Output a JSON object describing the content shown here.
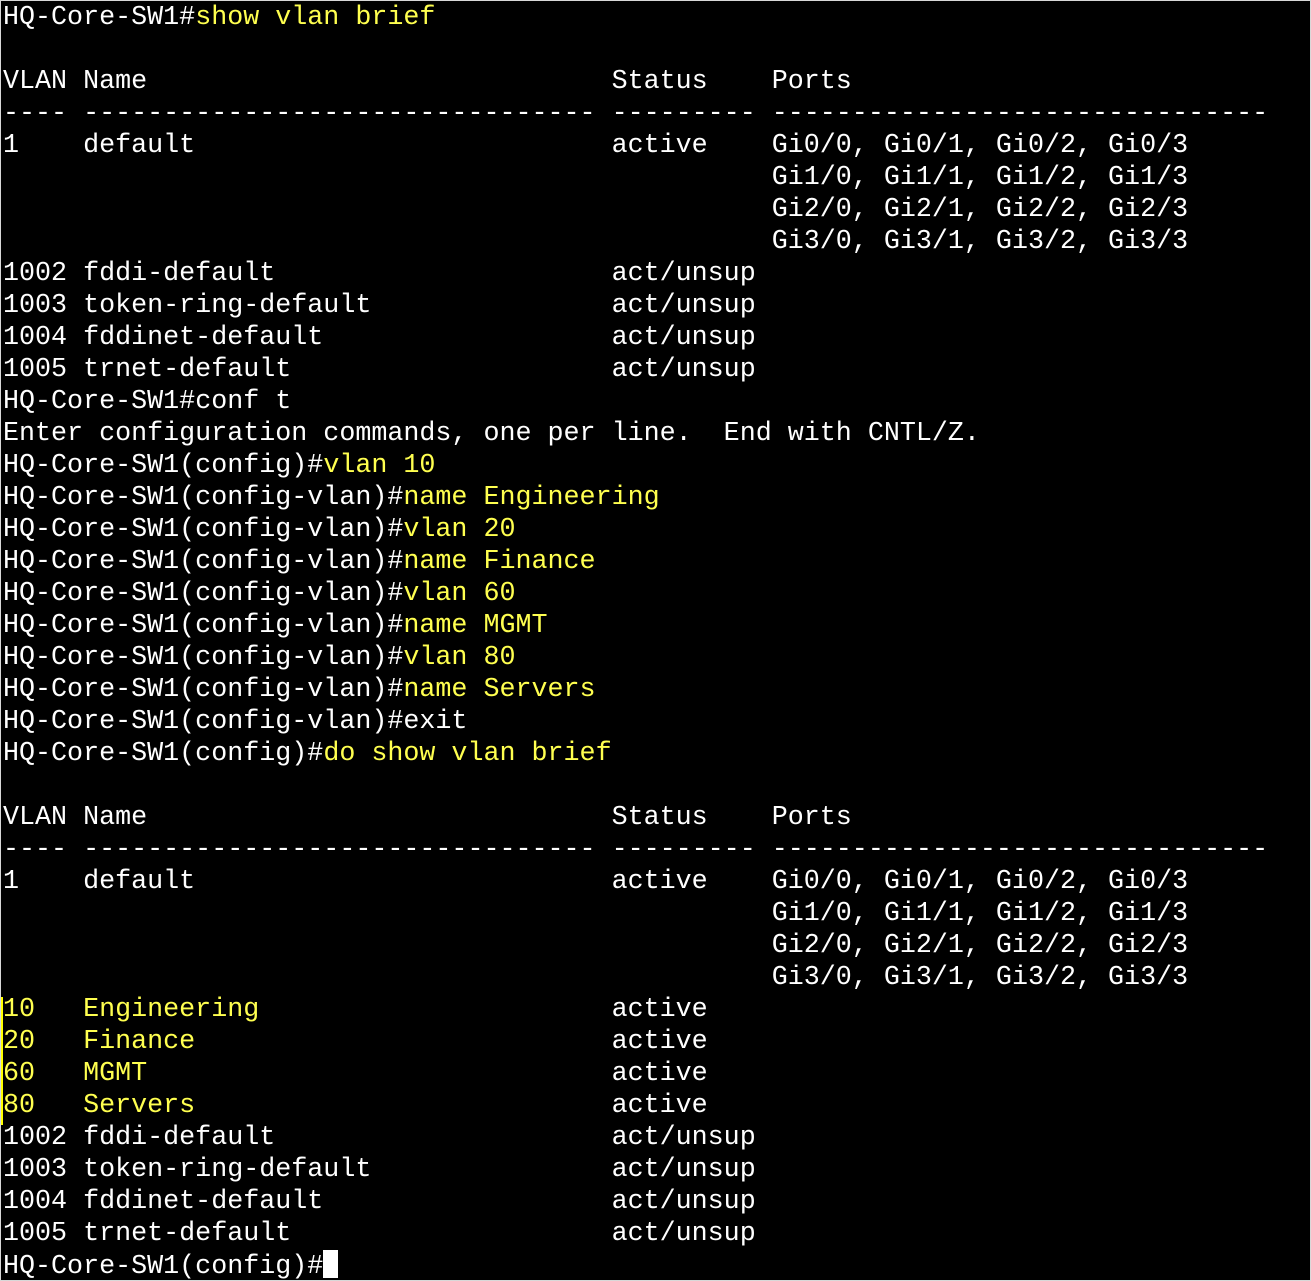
{
  "terminal": {
    "colors": {
      "background": "#000000",
      "output": "#ffffff",
      "command": "#ffff4f"
    },
    "lines": [
      [
        {
          "t": "HQ-Core-SW1#",
          "c": "w"
        },
        {
          "t": "show vlan brief",
          "c": "y"
        }
      ],
      [],
      [
        {
          "t": "VLAN Name                             Status    Ports",
          "c": "w"
        }
      ],
      [
        {
          "t": "---- -------------------------------- --------- -------------------------------",
          "c": "w"
        }
      ],
      [
        {
          "t": "1    default                          active    Gi0/0, Gi0/1, Gi0/2, Gi0/3",
          "c": "w"
        }
      ],
      [
        {
          "t": "                                                Gi1/0, Gi1/1, Gi1/2, Gi1/3",
          "c": "w"
        }
      ],
      [
        {
          "t": "                                                Gi2/0, Gi2/1, Gi2/2, Gi2/3",
          "c": "w"
        }
      ],
      [
        {
          "t": "                                                Gi3/0, Gi3/1, Gi3/2, Gi3/3",
          "c": "w"
        }
      ],
      [
        {
          "t": "1002 fddi-default                     act/unsup",
          "c": "w"
        }
      ],
      [
        {
          "t": "1003 token-ring-default               act/unsup",
          "c": "w"
        }
      ],
      [
        {
          "t": "1004 fddinet-default                  act/unsup",
          "c": "w"
        }
      ],
      [
        {
          "t": "1005 trnet-default                    act/unsup",
          "c": "w"
        }
      ],
      [
        {
          "t": "HQ-Core-SW1#",
          "c": "w"
        },
        {
          "t": "conf t",
          "c": "w"
        }
      ],
      [
        {
          "t": "Enter configuration commands, one per line.  End with CNTL/Z.",
          "c": "w"
        }
      ],
      [
        {
          "t": "HQ-Core-SW1(config)#",
          "c": "w"
        },
        {
          "t": "vlan 10",
          "c": "y"
        }
      ],
      [
        {
          "t": "HQ-Core-SW1(config-vlan)#",
          "c": "w"
        },
        {
          "t": "name Engineering",
          "c": "y"
        }
      ],
      [
        {
          "t": "HQ-Core-SW1(config-vlan)#",
          "c": "w"
        },
        {
          "t": "vlan 20",
          "c": "y"
        }
      ],
      [
        {
          "t": "HQ-Core-SW1(config-vlan)#",
          "c": "w"
        },
        {
          "t": "name Finance",
          "c": "y"
        }
      ],
      [
        {
          "t": "HQ-Core-SW1(config-vlan)#",
          "c": "w"
        },
        {
          "t": "vlan 60",
          "c": "y"
        }
      ],
      [
        {
          "t": "HQ-Core-SW1(config-vlan)#",
          "c": "w"
        },
        {
          "t": "name MGMT",
          "c": "y"
        }
      ],
      [
        {
          "t": "HQ-Core-SW1(config-vlan)#",
          "c": "w"
        },
        {
          "t": "vlan 80",
          "c": "y"
        }
      ],
      [
        {
          "t": "HQ-Core-SW1(config-vlan)#",
          "c": "w"
        },
        {
          "t": "name Servers",
          "c": "y"
        }
      ],
      [
        {
          "t": "HQ-Core-SW1(config-vlan)#",
          "c": "w"
        },
        {
          "t": "exit",
          "c": "w"
        }
      ],
      [
        {
          "t": "HQ-Core-SW1(config)#",
          "c": "w"
        },
        {
          "t": "do show vlan brief",
          "c": "y"
        }
      ],
      [],
      [
        {
          "t": "VLAN Name                             Status    Ports",
          "c": "w"
        }
      ],
      [
        {
          "t": "---- -------------------------------- --------- -------------------------------",
          "c": "w"
        }
      ],
      [
        {
          "t": "1    default                          active    Gi0/0, Gi0/1, Gi0/2, Gi0/3",
          "c": "w"
        }
      ],
      [
        {
          "t": "                                                Gi1/0, Gi1/1, Gi1/2, Gi1/3",
          "c": "w"
        }
      ],
      [
        {
          "t": "                                                Gi2/0, Gi2/1, Gi2/2, Gi2/3",
          "c": "w"
        }
      ],
      [
        {
          "t": "                                                Gi3/0, Gi3/1, Gi3/2, Gi3/3",
          "c": "w"
        }
      ],
      [
        {
          "t": "10   Engineering                      ",
          "c": "y"
        },
        {
          "t": "active",
          "c": "w"
        }
      ],
      [
        {
          "t": "20   Finance                          ",
          "c": "y"
        },
        {
          "t": "active",
          "c": "w"
        }
      ],
      [
        {
          "t": "60   MGMT                             ",
          "c": "y"
        },
        {
          "t": "active",
          "c": "w"
        }
      ],
      [
        {
          "t": "80   Servers                          ",
          "c": "y"
        },
        {
          "t": "active",
          "c": "w"
        }
      ],
      [
        {
          "t": "1002 fddi-default                     act/unsup",
          "c": "w"
        }
      ],
      [
        {
          "t": "1003 token-ring-default               act/unsup",
          "c": "w"
        }
      ],
      [
        {
          "t": "1004 fddinet-default                  act/unsup",
          "c": "w"
        }
      ],
      [
        {
          "t": "1005 trnet-default                    act/unsup",
          "c": "w"
        }
      ],
      [
        {
          "t": "HQ-Core-SW1(config)#",
          "c": "w"
        }
      ]
    ],
    "cursor_line": 39
  }
}
